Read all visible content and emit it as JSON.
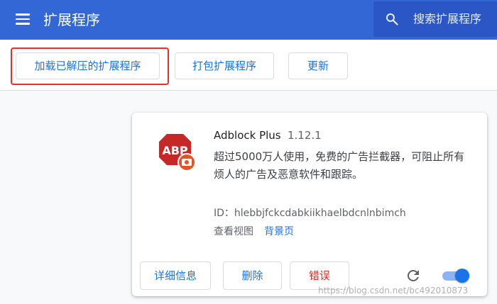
{
  "header": {
    "title": "扩展程序",
    "menu_icon": "menu-icon",
    "search": {
      "placeholder": "搜索扩展程序",
      "icon": "search-icon"
    },
    "colors": {
      "background": "#3367d6",
      "search_background": "#2a56c6"
    }
  },
  "toolbar": {
    "load_unpacked": "加载已解压的扩展程序",
    "pack_extension": "打包扩展程序",
    "update": "更新",
    "highlight_color": "#e8302a"
  },
  "extension": {
    "name": "Adblock Plus",
    "version": "1.12.1",
    "description": "超过5000万人使用，免费的广告拦截器，可阻止所有烦人的广告及恶意软件和跟踪。",
    "icon": "abp-icon",
    "id_label": "ID：",
    "id": "hlebbjfckcdabkiikhaelbdcnlnbimch",
    "inspect_views_label": "查看视图",
    "inspect_views_link": "背景页",
    "details_button": "详细信息",
    "remove_button": "删除",
    "errors_button": "错误",
    "reload_icon": "reload-icon",
    "enabled": true,
    "colors": {
      "accent": "#1a73e8",
      "error": "#d93025",
      "icon_red": "#c62828",
      "badge_orange": "#e65324"
    }
  },
  "watermark": "https://blog.csdn.net/bc492010873"
}
